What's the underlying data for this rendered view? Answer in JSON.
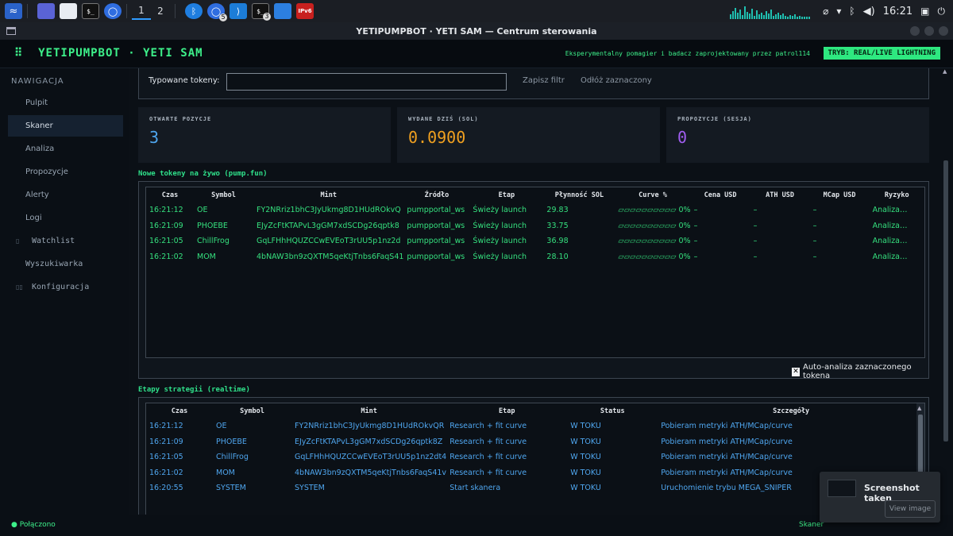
{
  "taskbar": {
    "workspaces": [
      "1",
      "2"
    ],
    "badge_a": "5",
    "badge_b": "3",
    "ipv6_label": "IPv6",
    "clock": "16:21"
  },
  "window": {
    "title": "YETIPUMPBOT · YETI SAM — Centrum sterowania"
  },
  "header": {
    "brand": "YETIPUMPBOT · YETI SAM",
    "brand_icon": "⠿",
    "tagline": "Eksperymentalny pomagier i badacz zaprojektowany przez patrol114",
    "mode": "TRYB: REAL/LIVE LIGHTNING"
  },
  "sidebar": {
    "title": "NAWIGACJA",
    "items": [
      {
        "label": "Pulpit",
        "icon": ""
      },
      {
        "label": "Skaner",
        "icon": ""
      },
      {
        "label": "Analiza",
        "icon": ""
      },
      {
        "label": "Propozycje",
        "icon": ""
      },
      {
        "label": "Alerty",
        "icon": ""
      },
      {
        "label": "Logi",
        "icon": ""
      },
      {
        "label": "Watchlist",
        "icon": "▯"
      },
      {
        "label": "Wyszukiwarka",
        "icon": ""
      },
      {
        "label": "Konfiguracja",
        "icon": "▯▯"
      }
    ]
  },
  "filter": {
    "label": "Typowane tokeny:",
    "value": "",
    "save": "Zapisz filtr",
    "defer": "Odłóż zaznaczony"
  },
  "stats": [
    {
      "label": "OTWARTE POZYCJE",
      "value": "3",
      "color": "#4fa6ef"
    },
    {
      "label": "WYDANE DZIŚ (SOL)",
      "value": "0.0900",
      "color": "#f0a020"
    },
    {
      "label": "PROPOZYCJE (SESJA)",
      "value": "0",
      "color": "#a05df0"
    }
  ],
  "live": {
    "title": "Nowe tokeny na żywo (pump.fun)",
    "columns": [
      "Czas",
      "Symbol",
      "Mint",
      "Źródło",
      "Etap",
      "Płynność SOL",
      "Curve %",
      "Cena USD",
      "ATH USD",
      "MCap USD",
      "Ryzyko"
    ],
    "rows": [
      [
        "16:21:12",
        "OE",
        "FY2NRriz1bhC3JyUkmg8D1HUdROkvQ",
        "pumpportal_ws",
        "Świeży launch",
        "29.83",
        "▱▱▱▱▱▱▱▱▱▱ 0%",
        "–",
        "–",
        "–",
        "Analiza…"
      ],
      [
        "16:21:09",
        "PHOEBE",
        "EJyZcFtKTAPvL3gGM7xdSCDg26qptk8",
        "pumpportal_ws",
        "Świeży launch",
        "33.75",
        "▱▱▱▱▱▱▱▱▱▱ 0%",
        "–",
        "–",
        "–",
        "Analiza…"
      ],
      [
        "16:21:05",
        "ChillFrog",
        "GqLFHhHQUZCCwEVEoT3rUU5p1nz2d",
        "pumpportal_ws",
        "Świeży launch",
        "36.98",
        "▱▱▱▱▱▱▱▱▱▱ 0%",
        "–",
        "–",
        "–",
        "Analiza…"
      ],
      [
        "16:21:02",
        "MOM",
        "4bNAW3bn9zQXTM5qeKtjTnbs6FaqS41",
        "pumpportal_ws",
        "Świeży launch",
        "28.10",
        "▱▱▱▱▱▱▱▱▱▱ 0%",
        "–",
        "–",
        "–",
        "Analiza…"
      ]
    ],
    "auto_label": "Auto-analiza zaznaczonego tokena",
    "auto_checked": true
  },
  "stages": {
    "title": "Etapy strategii (realtime)",
    "columns": [
      "Czas",
      "Symbol",
      "Mint",
      "Etap",
      "Status",
      "Szczegóły"
    ],
    "rows": [
      [
        "16:21:12",
        "OE",
        "FY2NRriz1bhC3JyUkmg8D1HUdROkvQR",
        "Research + fit curve",
        "W TOKU",
        "Pobieram metryki ATH/MCap/curve"
      ],
      [
        "16:21:09",
        "PHOEBE",
        "EJyZcFtKTAPvL3gGM7xdSCDg26qptk8Z",
        "Research + fit curve",
        "W TOKU",
        "Pobieram metryki ATH/MCap/curve"
      ],
      [
        "16:21:05",
        "ChillFrog",
        "GqLFHhHQUZCCwEVEoT3rUU5p1nz2dt4",
        "Research + fit curve",
        "W TOKU",
        "Pobieram metryki ATH/MCap/curve"
      ],
      [
        "16:21:02",
        "MOM",
        "4bNAW3bn9zQXTM5qeKtjTnbs6FaqS41v",
        "Research + fit curve",
        "W TOKU",
        "Pobieram metryki ATH/MCap/curve"
      ],
      [
        "16:20:55",
        "SYSTEM",
        "SYSTEM",
        "Start skanera",
        "W TOKU",
        "Uruchomienie trybu MEGA_SNIPER"
      ]
    ]
  },
  "status": {
    "connection": "● Połączono",
    "right": "Skaner"
  },
  "toast": {
    "title": "Screenshot taken",
    "button": "View image"
  },
  "colors": {
    "accent_green": "#35e07e",
    "accent_blue": "#4fa6ef",
    "mode_badge": "#2ee880"
  }
}
